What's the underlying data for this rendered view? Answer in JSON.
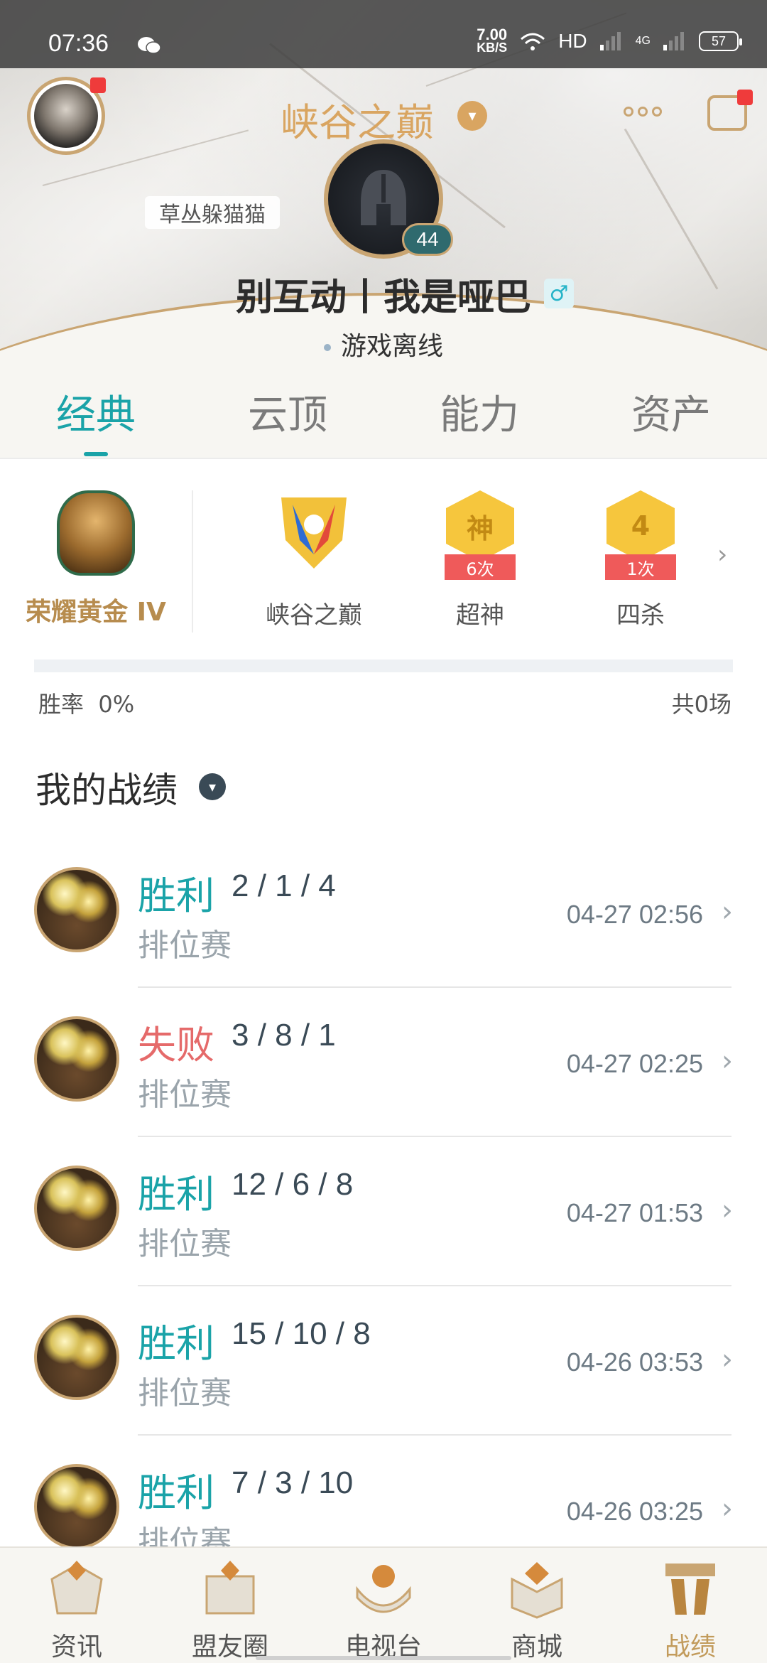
{
  "status_bar": {
    "time": "07:36",
    "net_speed_value": "7.00",
    "net_speed_unit": "KB/S",
    "network": "HD",
    "signal_label": "4G",
    "battery": "57"
  },
  "header": {
    "server_title": "峡谷之巅",
    "tag_label": "草丛躲猫猫",
    "level": "44",
    "player_name": "别互动丨我是哑巴",
    "gender_symbol": "♂",
    "online_status": "游戏离线"
  },
  "tabs": [
    {
      "label": "经典",
      "active": true
    },
    {
      "label": "云顶",
      "active": false
    },
    {
      "label": "能力",
      "active": false
    },
    {
      "label": "资产",
      "active": false
    }
  ],
  "achievements": {
    "rank_label": "荣耀黄金 IV",
    "items": [
      {
        "label": "峡谷之巅",
        "icon": "peak-badge-icon"
      },
      {
        "label": "超神",
        "badge_text": "神",
        "count": "6次",
        "icon": "godlike-badge-icon"
      },
      {
        "label": "四杀",
        "badge_text": "4",
        "count": "1次",
        "icon": "quadra-kill-badge-icon"
      }
    ]
  },
  "stats": {
    "winrate_label": "胜率",
    "winrate_value": "0%",
    "total_games": "共0场",
    "progress_fraction": 0
  },
  "section_title": "我的战绩",
  "matches": [
    {
      "result": "胜利",
      "outcome": "win",
      "kda": "2 / 1 / 4",
      "type": "排位赛",
      "time": "04-27 02:56"
    },
    {
      "result": "失败",
      "outcome": "loss",
      "kda": "3 / 8 / 1",
      "type": "排位赛",
      "time": "04-27 02:25"
    },
    {
      "result": "胜利",
      "outcome": "win",
      "kda": "12 / 6 / 8",
      "type": "排位赛",
      "time": "04-27 01:53"
    },
    {
      "result": "胜利",
      "outcome": "win",
      "kda": "15 / 10 / 8",
      "type": "排位赛",
      "time": "04-26 03:53"
    },
    {
      "result": "胜利",
      "outcome": "win",
      "kda": "7 / 3 / 10",
      "type": "排位赛",
      "time": "04-26 03:25"
    }
  ],
  "bottom_nav": [
    {
      "label": "资讯",
      "active": false
    },
    {
      "label": "盟友圈",
      "active": false
    },
    {
      "label": "电视台",
      "active": false
    },
    {
      "label": "商城",
      "active": false
    },
    {
      "label": "战绩",
      "active": true
    }
  ],
  "colors": {
    "accent_teal": "#1aa3a8",
    "gold": "#c9a572",
    "loss_red": "#e56a6a"
  }
}
